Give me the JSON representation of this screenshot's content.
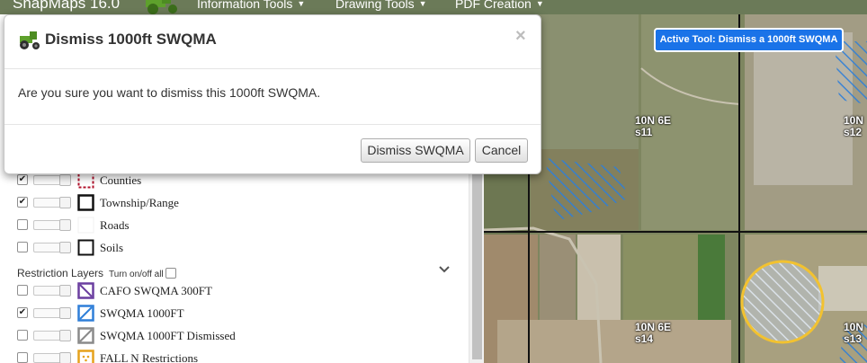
{
  "app": {
    "name": "SnapMaps 16.0"
  },
  "navbar": {
    "items": [
      {
        "label": "Information Tools"
      },
      {
        "label": "Drawing Tools"
      },
      {
        "label": "PDF Creation"
      }
    ]
  },
  "layers": {
    "base": [
      {
        "label": "Counties",
        "checked": true,
        "swatch": "counties"
      },
      {
        "label": "Township/Range",
        "checked": true,
        "swatch": "township"
      },
      {
        "label": "Roads",
        "checked": false,
        "swatch": "roads"
      },
      {
        "label": "Soils",
        "checked": false,
        "swatch": "soils"
      }
    ],
    "restriction_section": {
      "title": "Restriction Layers",
      "toggle_label": "Turn on/off all"
    },
    "restriction": [
      {
        "label": "CAFO SWQMA 300FT",
        "checked": false,
        "swatch": "cafo"
      },
      {
        "label": "SWQMA 1000FT",
        "checked": true,
        "swatch": "swqma"
      },
      {
        "label": "SWQMA 1000FT Dismissed",
        "checked": false,
        "swatch": "dismissed"
      },
      {
        "label": "FALL N Restrictions",
        "checked": false,
        "swatch": "falln"
      }
    ]
  },
  "map": {
    "active_tool": "Active Tool: Dismiss a 1000ft SWQMA",
    "labels": [
      {
        "text": "10N 6E\ns11"
      },
      {
        "text": "10N\ns12"
      },
      {
        "text": "10N 6E\ns14"
      },
      {
        "text": "10N\ns13"
      }
    ]
  },
  "modal": {
    "title": "Dismiss 1000ft SWQMA",
    "close": "×",
    "body": "Are you sure you want to dismiss this 1000ft SWQMA.",
    "confirm_label": "Dismiss SWQMA",
    "cancel_label": "Cancel"
  },
  "colors": {
    "navbar": "#6b7a58",
    "active_tool": "#1a73e8",
    "swqma_hatch": "#2f7fd8",
    "buffer_circle": "#f2c230"
  }
}
